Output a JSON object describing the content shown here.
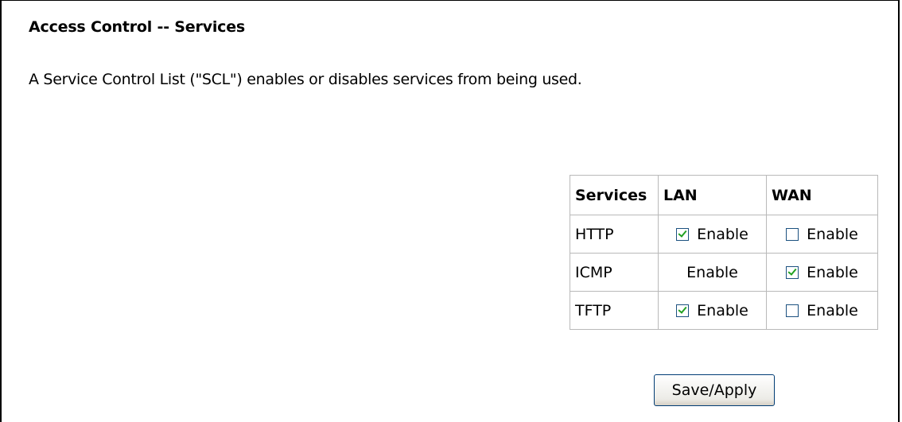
{
  "page": {
    "title": "Access Control -- Services",
    "description": "A Service Control List (\"SCL\") enables or disables services from being used."
  },
  "table": {
    "headers": [
      "Services",
      "LAN",
      "WAN"
    ],
    "rows": [
      {
        "service": "HTTP",
        "lan": {
          "label": "Enable",
          "checkbox": true,
          "checked": true
        },
        "wan": {
          "label": "Enable",
          "checkbox": true,
          "checked": false
        }
      },
      {
        "service": "ICMP",
        "lan": {
          "label": "Enable",
          "checkbox": false,
          "checked": false
        },
        "wan": {
          "label": "Enable",
          "checkbox": true,
          "checked": true
        }
      },
      {
        "service": "TFTP",
        "lan": {
          "label": "Enable",
          "checkbox": true,
          "checked": true
        },
        "wan": {
          "label": "Enable",
          "checkbox": true,
          "checked": false
        }
      }
    ]
  },
  "actions": {
    "save_label": "Save/Apply"
  },
  "colors": {
    "checkmark": "#21a121",
    "checkbox_border": "#1c5180",
    "table_border": "#b9b9b9"
  }
}
